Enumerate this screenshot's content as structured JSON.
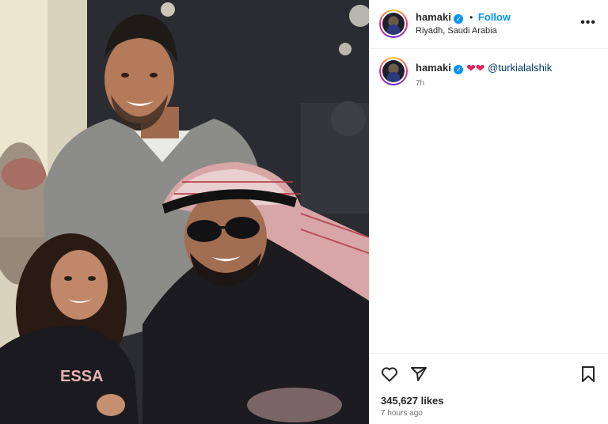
{
  "post": {
    "username": "hamaki",
    "follow_label": "Follow",
    "location": "Riyadh, Saudi Arabia",
    "more_label": "•••",
    "caption": {
      "username": "hamaki",
      "emojis": "❤❤",
      "mention": "@turkialalshik",
      "time": "7h"
    },
    "likes": "345,627 likes",
    "posted": "7 hours ago",
    "shirt_text": "ESSA"
  },
  "colors": {
    "accent": "#0095f6",
    "mention": "#00376b",
    "heart": "#e0245e"
  },
  "icons": [
    "heart-icon",
    "share-icon",
    "bookmark-icon",
    "verified-icon",
    "more-options-icon"
  ]
}
